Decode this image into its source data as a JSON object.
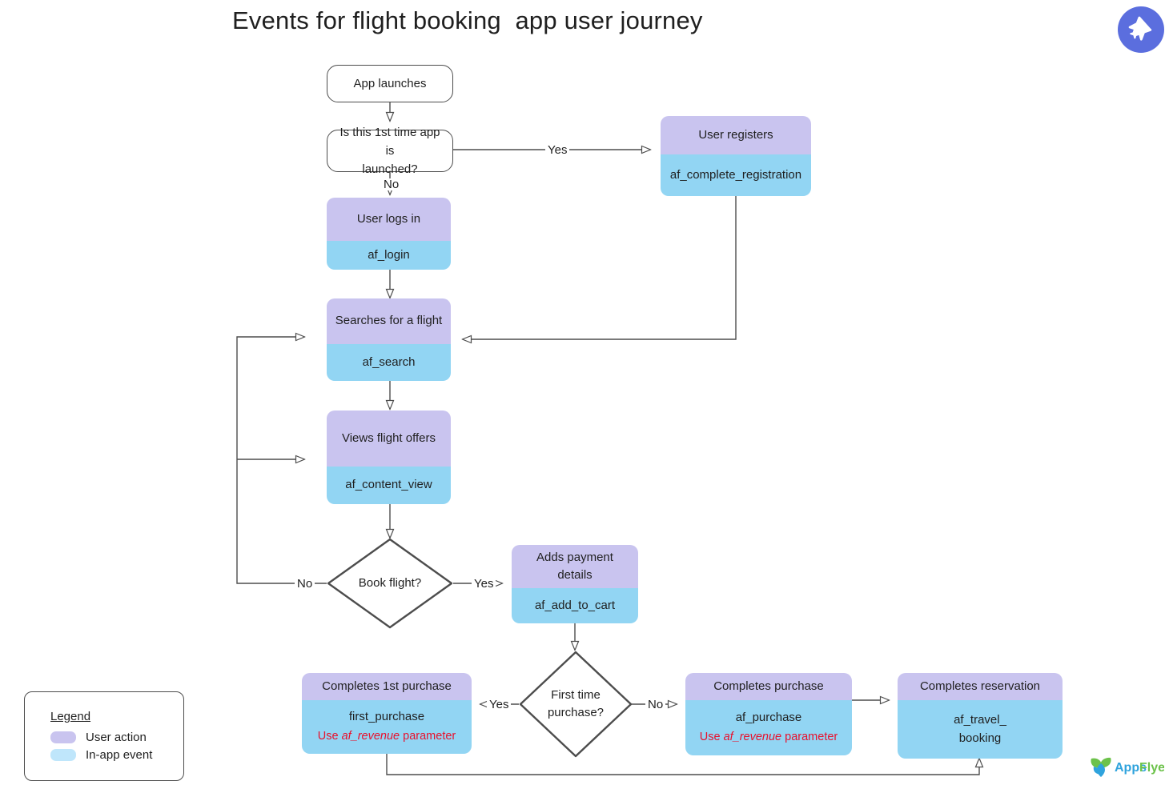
{
  "header": {
    "title": "Events for flight booking  app user journey",
    "badge_icon": "airplane-icon",
    "badge_color": "#5b6ede"
  },
  "colors": {
    "user_action": "#c9c4ef",
    "in_app_event": "#92d5f3",
    "parameter_note": "#e8112d",
    "stroke": "#4d4d4d"
  },
  "nodes": {
    "app_launches": {
      "label": "App launches"
    },
    "first_launch_decision": {
      "line1": "Is this 1st time app is",
      "line2": "launched?"
    },
    "user_registers": {
      "action": "User registers",
      "event": "af_complete_registration"
    },
    "user_logs_in": {
      "action": "User logs in",
      "event": "af_login"
    },
    "searches_flight": {
      "action": "Searches for a flight",
      "event": "af_search"
    },
    "views_offers": {
      "action": "Views flight offers",
      "event": "af_content_view"
    },
    "book_flight_decision": {
      "label": "Book flight?"
    },
    "adds_payment": {
      "action_line1": "Adds payment",
      "action_line2": "details",
      "event": "af_add_to_cart"
    },
    "first_time_purchase_decision": {
      "line1": "First time",
      "line2": "purchase?"
    },
    "completes_first_purchase": {
      "action": "Completes 1st purchase",
      "event": "first_purchase",
      "param_prefix": "Use ",
      "param_name": "af_revenue",
      "param_suffix": " parameter"
    },
    "completes_purchase": {
      "action": "Completes purchase",
      "event": "af_purchase",
      "param_prefix": "Use ",
      "param_name": "af_revenue",
      "param_suffix": " parameter"
    },
    "completes_reservation": {
      "action": "Completes reservation",
      "event_line1": "af_travel_",
      "event_line2": "booking"
    }
  },
  "edge_labels": {
    "first_launch_yes": "Yes",
    "first_launch_no": "No",
    "book_flight_yes": "Yes",
    "book_flight_no": "No",
    "first_time_yes": "Yes",
    "first_time_no": "No"
  },
  "legend": {
    "title": "Legend",
    "items": [
      {
        "label": "User action",
        "color": "#c9c4ef"
      },
      {
        "label": "In-app event",
        "color": "#bfe6fb"
      }
    ]
  },
  "brand": {
    "name_part1": "Apps",
    "name_part2": "Flyer",
    "color1": "#2fa3dd",
    "color2": "#6cc24a"
  }
}
